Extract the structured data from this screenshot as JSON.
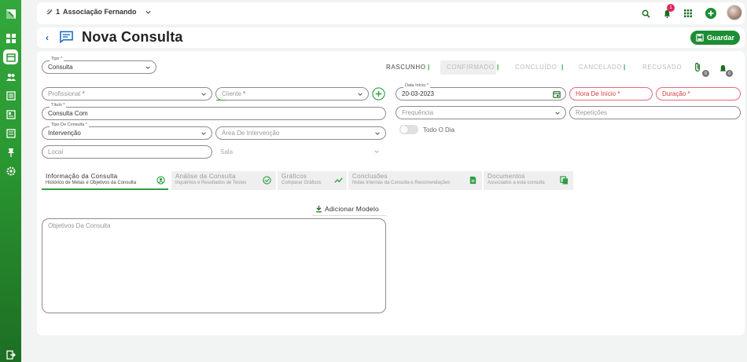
{
  "topbar": {
    "org_prefix": "1",
    "org_name": "Associação Fernando",
    "notification_count": "1"
  },
  "header": {
    "title": "Nova Consulta",
    "save_label": "Guardar"
  },
  "status_bar": {
    "states": [
      "RASCUNHO",
      "CONFIRMADO",
      "CONCLUÍDO",
      "CANCELADO",
      "RECUSADO"
    ],
    "separator": "|",
    "attachments_count": "0",
    "alerts_count": "0"
  },
  "form": {
    "tipo": {
      "label": "Tipo *",
      "value": "Consulta"
    },
    "profissional": {
      "placeholder": "Profissional",
      "req": "*"
    },
    "cliente": {
      "placeholder": "Cliente",
      "req": "*"
    },
    "titulo": {
      "label": "Título *",
      "value": "Consulta Com"
    },
    "tipo_consulta": {
      "label": "Tipo De Consulta *",
      "value": "Intervenção"
    },
    "area": {
      "placeholder": "Área De Intervenção"
    },
    "local": {
      "placeholder": "Local"
    },
    "sala": {
      "placeholder": "Sala"
    },
    "data_inicio": {
      "label": "Data Início *",
      "value": "20-03-2023"
    },
    "hora_inicio": {
      "placeholder": "Hora De Início",
      "req": "*"
    },
    "duracao": {
      "placeholder": "Duração",
      "req": "*"
    },
    "frequencia": {
      "placeholder": "Frequência"
    },
    "repeticoes": {
      "placeholder": "Repetições"
    },
    "todo_dia": {
      "label": "Todo O Dia"
    }
  },
  "tabs": [
    {
      "title": "Informação da Consulta",
      "subtitle": "Histórico de Metas e Objetivos da Consulta"
    },
    {
      "title": "Análise da Consulta",
      "subtitle": "Inquéritos e Resultados de Testes"
    },
    {
      "title": "Gráficos",
      "subtitle": "Comparar Gráficos"
    },
    {
      "title": "Conclusões",
      "subtitle": "Notas Internas da Consulta e Recomendações"
    },
    {
      "title": "Documentos",
      "subtitle": "Associados a esta consulta"
    }
  ],
  "content": {
    "add_model_label": "Adicionar Modelo",
    "objectives_placeholder": "Objetivos Da Consulta"
  },
  "colors": {
    "brand_green": "#2f9e44",
    "save_green": "#1d8d34",
    "required_red": "#d23a3a",
    "link_blue": "#1565c0"
  }
}
